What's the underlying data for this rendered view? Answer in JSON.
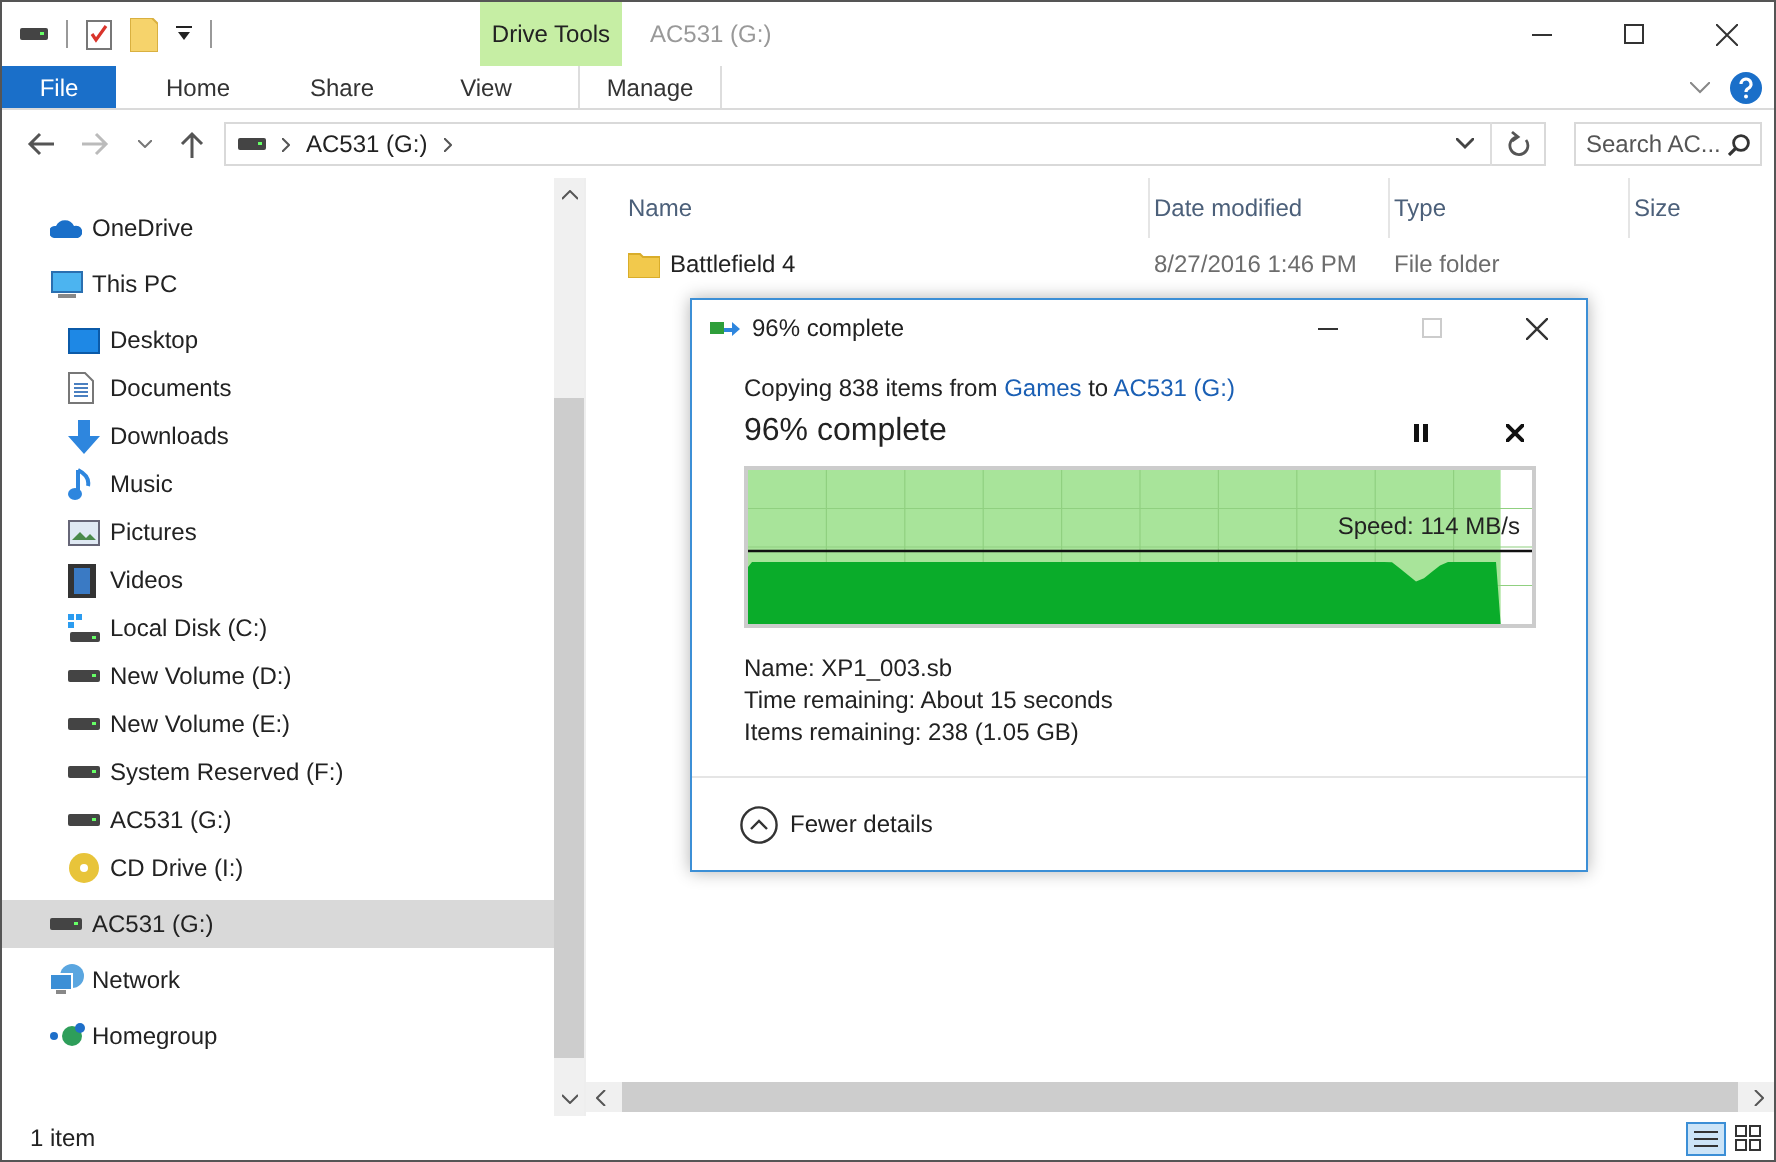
{
  "window": {
    "title": "AC531 (G:)",
    "context_tab_group": "Drive Tools"
  },
  "ribbon_tabs": [
    {
      "label": "File",
      "kind": "file",
      "selected": false
    },
    {
      "label": "Home",
      "kind": "tab",
      "selected": false
    },
    {
      "label": "Share",
      "kind": "tab",
      "selected": false
    },
    {
      "label": "View",
      "kind": "tab",
      "selected": false
    },
    {
      "label": "Manage",
      "kind": "context",
      "selected": false
    }
  ],
  "address_bar": {
    "path": [
      "AC531 (G:)"
    ]
  },
  "search": {
    "placeholder": "Search AC..."
  },
  "sidebar": {
    "items": [
      {
        "label": "OneDrive",
        "kind": "cloud",
        "selected": false
      },
      {
        "label": "This PC",
        "kind": "pc",
        "selected": false,
        "children": [
          {
            "label": "Desktop",
            "kind": "desktop",
            "selected": false
          },
          {
            "label": "Documents",
            "kind": "documents",
            "selected": false
          },
          {
            "label": "Downloads",
            "kind": "downloads",
            "selected": false
          },
          {
            "label": "Music",
            "kind": "music",
            "selected": false
          },
          {
            "label": "Pictures",
            "kind": "pictures",
            "selected": false
          },
          {
            "label": "Videos",
            "kind": "videos",
            "selected": false
          },
          {
            "label": "Local Disk (C:)",
            "kind": "system-drive",
            "selected": false
          },
          {
            "label": "New Volume (D:)",
            "kind": "drive",
            "selected": false
          },
          {
            "label": "New Volume (E:)",
            "kind": "drive",
            "selected": false
          },
          {
            "label": "System Reserved (F:)",
            "kind": "drive",
            "selected": false
          },
          {
            "label": "AC531 (G:)",
            "kind": "drive",
            "selected": false
          },
          {
            "label": "CD Drive (I:)",
            "kind": "cd",
            "selected": false
          }
        ]
      },
      {
        "label": "AC531 (G:)",
        "kind": "drive",
        "selected": true
      },
      {
        "label": "Network",
        "kind": "network",
        "selected": false
      },
      {
        "label": "Homegroup",
        "kind": "homegroup",
        "selected": false
      }
    ]
  },
  "file_list": {
    "columns": [
      "Name",
      "Date modified",
      "Type",
      "Size"
    ],
    "rows": [
      {
        "name": "Battlefield 4",
        "date_modified": "8/27/2016 1:46 PM",
        "type": "File folder"
      }
    ]
  },
  "status_bar": {
    "item_count": "1 item"
  },
  "copy_dialog": {
    "title": "96% complete",
    "copying_prefix": "Copying 838 items from",
    "source": "Games",
    "copying_middle": "to",
    "destination": "AC531 (G:)",
    "heading": "96% complete",
    "progress": {
      "level": 0.96,
      "speed": "Speed: 114 MB/s"
    },
    "details": [
      "Name:  XP1_003.sb",
      "Time remaining:  About 15 seconds",
      "Items remaining:  238 (1.05 GB)"
    ],
    "toggle": "Fewer details"
  }
}
